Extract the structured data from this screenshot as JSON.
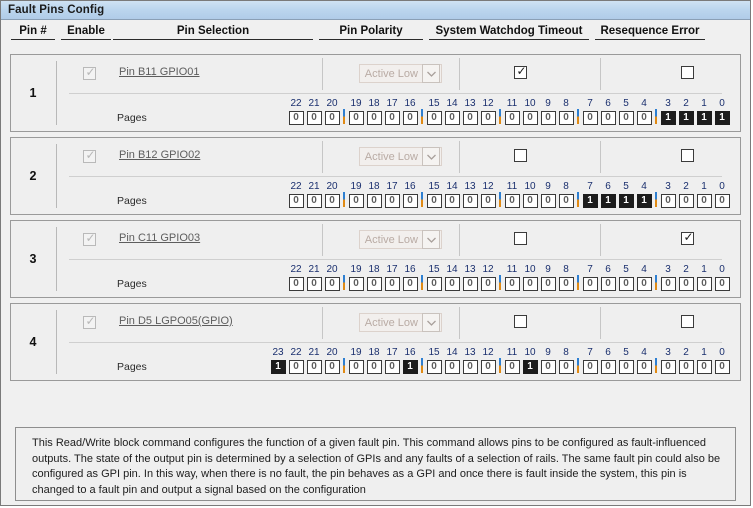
{
  "window": {
    "title": "Fault Pins Config"
  },
  "columns": {
    "pin_number": "Pin #",
    "enable": "Enable",
    "pin_selection": "Pin Selection",
    "pin_polarity": "Pin Polarity",
    "system_watchdog_timeout": "System Watchdog Timeout",
    "resequence_error": "Resequence Error"
  },
  "labels": {
    "pages": "Pages",
    "checked_glyph": "✓",
    "chevron_down_icon": "chevron-down-icon"
  },
  "colors": {
    "titlebar_start": "#cfe2f3",
    "titlebar_end": "#b0cce8",
    "panel_background": "#f0f0f0",
    "bit_number": "#1a2f6e",
    "bit_on_background": "#1c1c1c",
    "bit_off_text": "#5e5e5e",
    "group_separator_blue": "#2e7fd1",
    "group_separator_orange": "#e08a14",
    "pin_link": "#5d5d5d",
    "combo_disabled_text": "#b9aba4"
  },
  "rows": [
    {
      "index": "1",
      "enable_checked": true,
      "enable_disabled": true,
      "pin_selection": "Pin B11 GPIO01",
      "polarity_value": "Active Low",
      "polarity_disabled": true,
      "watchdog_checked": true,
      "resequence_checked": false,
      "bits": [
        {
          "n": "22",
          "v": "0"
        },
        {
          "n": "21",
          "v": "0"
        },
        {
          "n": "20",
          "v": "0"
        },
        {
          "sep": true
        },
        {
          "n": "19",
          "v": "0"
        },
        {
          "n": "18",
          "v": "0"
        },
        {
          "n": "17",
          "v": "0"
        },
        {
          "n": "16",
          "v": "0"
        },
        {
          "sep": true
        },
        {
          "n": "15",
          "v": "0"
        },
        {
          "n": "14",
          "v": "0"
        },
        {
          "n": "13",
          "v": "0"
        },
        {
          "n": "12",
          "v": "0"
        },
        {
          "sep": true
        },
        {
          "n": "11",
          "v": "0"
        },
        {
          "n": "10",
          "v": "0"
        },
        {
          "n": "9",
          "v": "0"
        },
        {
          "n": "8",
          "v": "0"
        },
        {
          "sep": true
        },
        {
          "n": "7",
          "v": "0"
        },
        {
          "n": "6",
          "v": "0"
        },
        {
          "n": "5",
          "v": "0"
        },
        {
          "n": "4",
          "v": "0"
        },
        {
          "sep": true
        },
        {
          "n": "3",
          "v": "1"
        },
        {
          "n": "2",
          "v": "1"
        },
        {
          "n": "1",
          "v": "1"
        },
        {
          "n": "0",
          "v": "1"
        }
      ]
    },
    {
      "index": "2",
      "enable_checked": true,
      "enable_disabled": true,
      "pin_selection": "Pin B12 GPIO02",
      "polarity_value": "Active Low",
      "polarity_disabled": true,
      "watchdog_checked": false,
      "resequence_checked": false,
      "bits": [
        {
          "n": "22",
          "v": "0"
        },
        {
          "n": "21",
          "v": "0"
        },
        {
          "n": "20",
          "v": "0"
        },
        {
          "sep": true
        },
        {
          "n": "19",
          "v": "0"
        },
        {
          "n": "18",
          "v": "0"
        },
        {
          "n": "17",
          "v": "0"
        },
        {
          "n": "16",
          "v": "0"
        },
        {
          "sep": true
        },
        {
          "n": "15",
          "v": "0"
        },
        {
          "n": "14",
          "v": "0"
        },
        {
          "n": "13",
          "v": "0"
        },
        {
          "n": "12",
          "v": "0"
        },
        {
          "sep": true
        },
        {
          "n": "11",
          "v": "0"
        },
        {
          "n": "10",
          "v": "0"
        },
        {
          "n": "9",
          "v": "0"
        },
        {
          "n": "8",
          "v": "0"
        },
        {
          "sep": true
        },
        {
          "n": "7",
          "v": "1"
        },
        {
          "n": "6",
          "v": "1"
        },
        {
          "n": "5",
          "v": "1"
        },
        {
          "n": "4",
          "v": "1"
        },
        {
          "sep": true
        },
        {
          "n": "3",
          "v": "0"
        },
        {
          "n": "2",
          "v": "0"
        },
        {
          "n": "1",
          "v": "0"
        },
        {
          "n": "0",
          "v": "0"
        }
      ]
    },
    {
      "index": "3",
      "enable_checked": true,
      "enable_disabled": true,
      "pin_selection": "Pin C11 GPIO03",
      "polarity_value": "Active Low",
      "polarity_disabled": true,
      "watchdog_checked": false,
      "resequence_checked": true,
      "bits": [
        {
          "n": "22",
          "v": "0"
        },
        {
          "n": "21",
          "v": "0"
        },
        {
          "n": "20",
          "v": "0"
        },
        {
          "sep": true
        },
        {
          "n": "19",
          "v": "0"
        },
        {
          "n": "18",
          "v": "0"
        },
        {
          "n": "17",
          "v": "0"
        },
        {
          "n": "16",
          "v": "0"
        },
        {
          "sep": true
        },
        {
          "n": "15",
          "v": "0"
        },
        {
          "n": "14",
          "v": "0"
        },
        {
          "n": "13",
          "v": "0"
        },
        {
          "n": "12",
          "v": "0"
        },
        {
          "sep": true
        },
        {
          "n": "11",
          "v": "0"
        },
        {
          "n": "10",
          "v": "0"
        },
        {
          "n": "9",
          "v": "0"
        },
        {
          "n": "8",
          "v": "0"
        },
        {
          "sep": true
        },
        {
          "n": "7",
          "v": "0"
        },
        {
          "n": "6",
          "v": "0"
        },
        {
          "n": "5",
          "v": "0"
        },
        {
          "n": "4",
          "v": "0"
        },
        {
          "sep": true
        },
        {
          "n": "3",
          "v": "0"
        },
        {
          "n": "2",
          "v": "0"
        },
        {
          "n": "1",
          "v": "0"
        },
        {
          "n": "0",
          "v": "0"
        }
      ]
    },
    {
      "index": "4",
      "enable_checked": true,
      "enable_disabled": true,
      "pin_selection": "Pin D5 LGPO05(GPIO)",
      "polarity_value": "Active Low",
      "polarity_disabled": true,
      "watchdog_checked": false,
      "resequence_checked": false,
      "bits": [
        {
          "n": "23",
          "v": "1"
        },
        {
          "n": "22",
          "v": "0"
        },
        {
          "n": "21",
          "v": "0"
        },
        {
          "n": "20",
          "v": "0"
        },
        {
          "sep": true
        },
        {
          "n": "19",
          "v": "0"
        },
        {
          "n": "18",
          "v": "0"
        },
        {
          "n": "17",
          "v": "0"
        },
        {
          "n": "16",
          "v": "1"
        },
        {
          "sep": true
        },
        {
          "n": "15",
          "v": "0"
        },
        {
          "n": "14",
          "v": "0"
        },
        {
          "n": "13",
          "v": "0"
        },
        {
          "n": "12",
          "v": "0"
        },
        {
          "sep": true
        },
        {
          "n": "11",
          "v": "0"
        },
        {
          "n": "10",
          "v": "1"
        },
        {
          "n": "9",
          "v": "0"
        },
        {
          "n": "8",
          "v": "0"
        },
        {
          "sep": true
        },
        {
          "n": "7",
          "v": "0"
        },
        {
          "n": "6",
          "v": "0"
        },
        {
          "n": "5",
          "v": "0"
        },
        {
          "n": "4",
          "v": "0"
        },
        {
          "sep": true
        },
        {
          "n": "3",
          "v": "0"
        },
        {
          "n": "2",
          "v": "0"
        },
        {
          "n": "1",
          "v": "0"
        },
        {
          "n": "0",
          "v": "0"
        }
      ]
    }
  ],
  "description": "This Read/Write block command configures the function of a given fault pin. This command allows pins to be configured as fault-influenced outputs. The state of the output pin is determined by a selection of GPIs and any faults of a selection of rails. The same fault pin could also be configured as GPI pin. In this way, when there is no fault, the pin behaves as a GPI and once there is fault inside the system, this pin is changed to a fault pin and output a signal based on the configuration"
}
